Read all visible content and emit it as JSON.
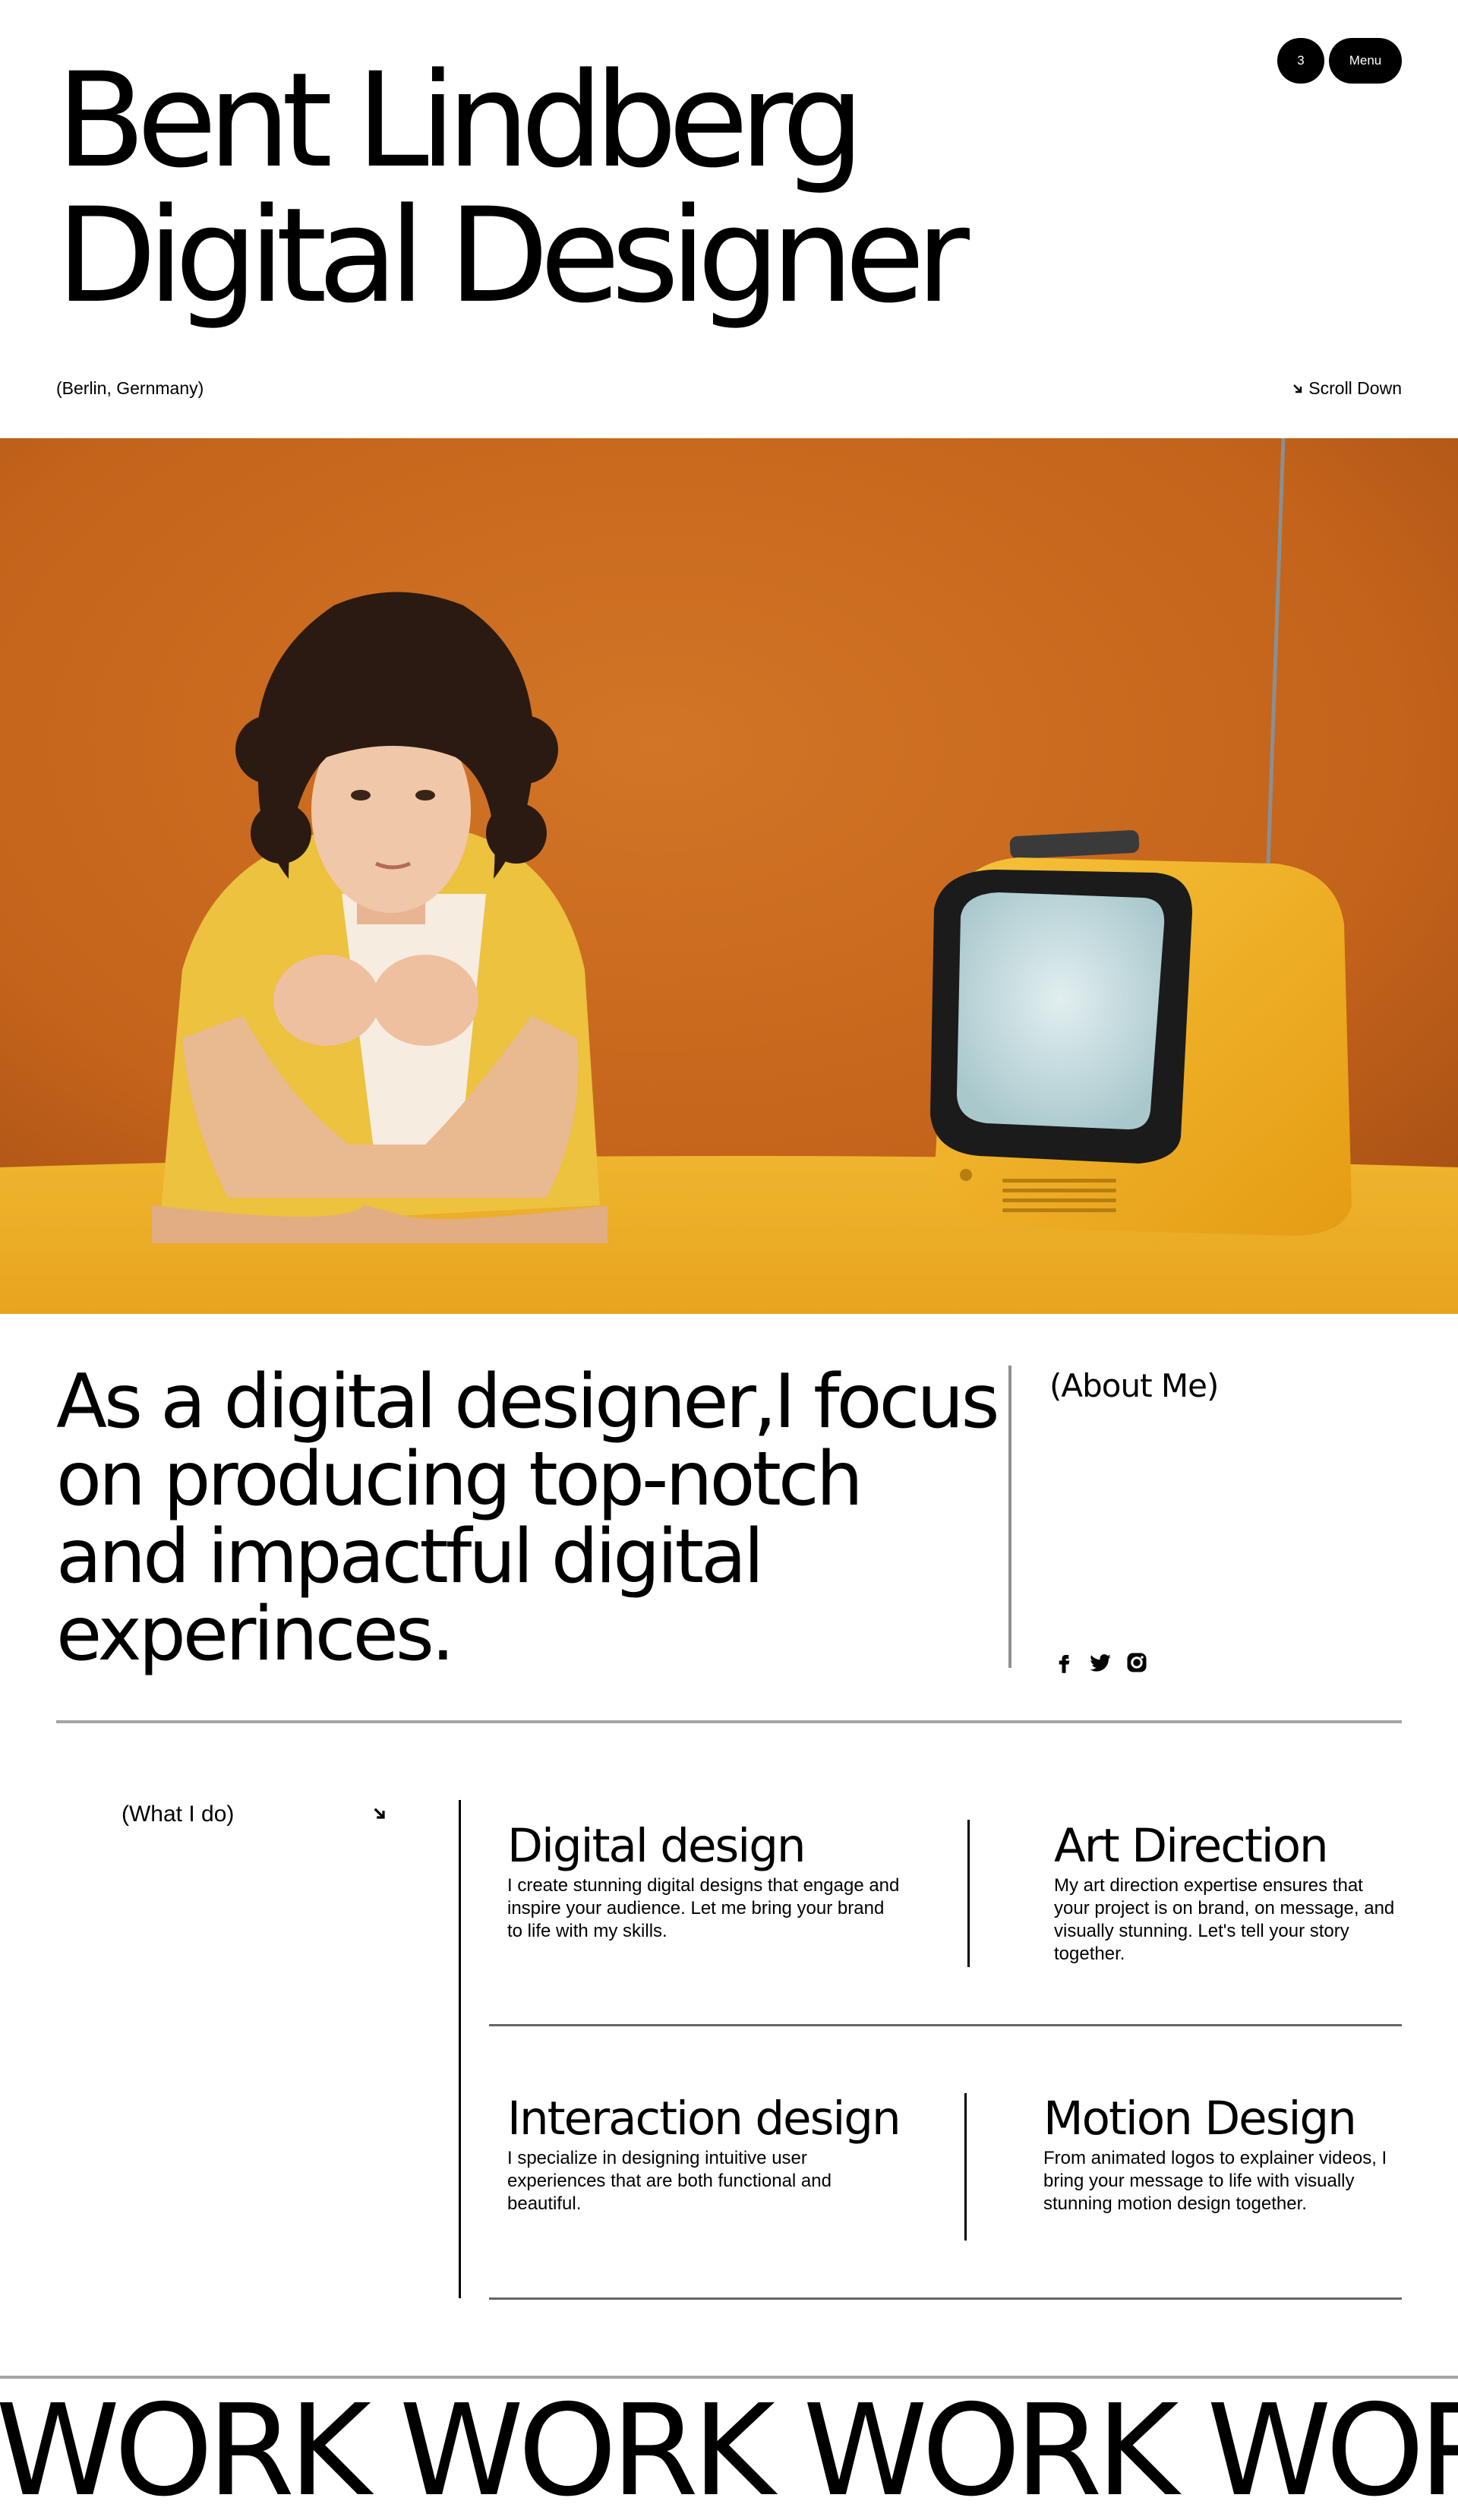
{
  "header": {
    "name_line": "Bent Lindberg",
    "role_line": "Digital Designer",
    "count_badge": "3",
    "menu_label": "Menu",
    "location": "(Berlin, Gernmany)",
    "scroll_label": "Scroll Down"
  },
  "hero": {
    "image": "portrait-with-yellow-tv",
    "colors": {
      "background": "#c8661c",
      "table": "#efb12b",
      "shirt": "#efc93e",
      "tv": "#f3b11f",
      "screen": "#cfe2e4"
    }
  },
  "about": {
    "statement": "As a digital designer,I focus on producing top-notch and impactful digital experinces.",
    "label": "(About Me)",
    "socials": [
      "facebook-icon",
      "twitter-icon",
      "instagram-icon"
    ]
  },
  "what_i_do": {
    "label": "(What I do)",
    "services": [
      {
        "title": "Digital design",
        "description": "I create stunning digital designs that engage and inspire your audience. Let me bring your brand to life with my skills."
      },
      {
        "title": "Art Direction",
        "description": "My art direction expertise ensures that your project is on brand, on message, and visually stunning. Let's tell your story together."
      },
      {
        "title": "Interaction design",
        "description": "I specialize in designing intuitive user experiences that are both functional and beautiful."
      },
      {
        "title": "Motion Design",
        "description": "From animated logos to explainer videos, I bring your message to life with visually stunning motion design together."
      }
    ]
  },
  "work": {
    "marquee": "WORK WORK WORK WORK"
  }
}
